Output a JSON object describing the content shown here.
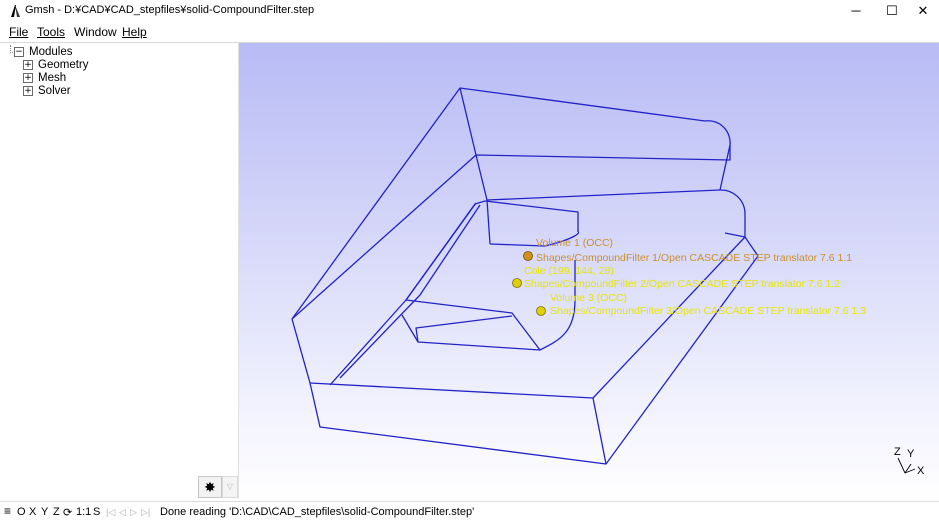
{
  "window": {
    "title": "Gmsh - D:¥CAD¥CAD_stepfiles¥solid-CompoundFilter.step",
    "app_icon": "gmsh-logo-icon",
    "controls": {
      "minimize": "─",
      "maximize": "☐",
      "close": "✕"
    }
  },
  "menu": [
    "File",
    "Tools",
    "Window",
    "Help"
  ],
  "tree": {
    "root": {
      "label": "Modules",
      "toggle": "−"
    },
    "children": [
      {
        "label": "Geometry",
        "toggle": "+"
      },
      {
        "label": "Mesh",
        "toggle": "+"
      },
      {
        "label": "Solver",
        "toggle": "+"
      }
    ]
  },
  "sidebar_tools": {
    "gear_icon": "gear-icon",
    "gear_glyph": "✸",
    "arrow_glyph": "▽"
  },
  "viewport": {
    "background_top": "#b8bbf5",
    "background_bottom": "#ffffff",
    "wire_color": "#2222c8",
    "label_color_volume1": "#c9902e",
    "label_color_other": "#e6e600",
    "labels": [
      "Volume 1 (OCC)",
      "Shapes/CompoundFilter 1/Open CASCADE STEP translator 7.6 1.1",
      "Cole (199, 144, 28)",
      "Shapes/CompoundFilter 2/Open CASCADE STEP translator 7.6 1.2",
      "Volume 3 (OCC)",
      "Shapes/CompoundFilter 3/Open CASCADE STEP translator 7.6 1.3"
    ],
    "axes": {
      "z": "Z",
      "y": "Y",
      "x": "X"
    }
  },
  "status": {
    "menu_icon": "≡",
    "view_buttons": [
      "O",
      "X",
      "Y",
      "Z"
    ],
    "rotate_icon": "rotate-icon",
    "rotate_glyph": "⟳",
    "scale": "1:1",
    "snap": "S",
    "nav_glyphs": [
      "|◁",
      "◁",
      "▷",
      "▷|"
    ],
    "message": "Done reading 'D:\\CAD\\CAD_stepfiles\\solid-CompoundFilter.step'"
  }
}
